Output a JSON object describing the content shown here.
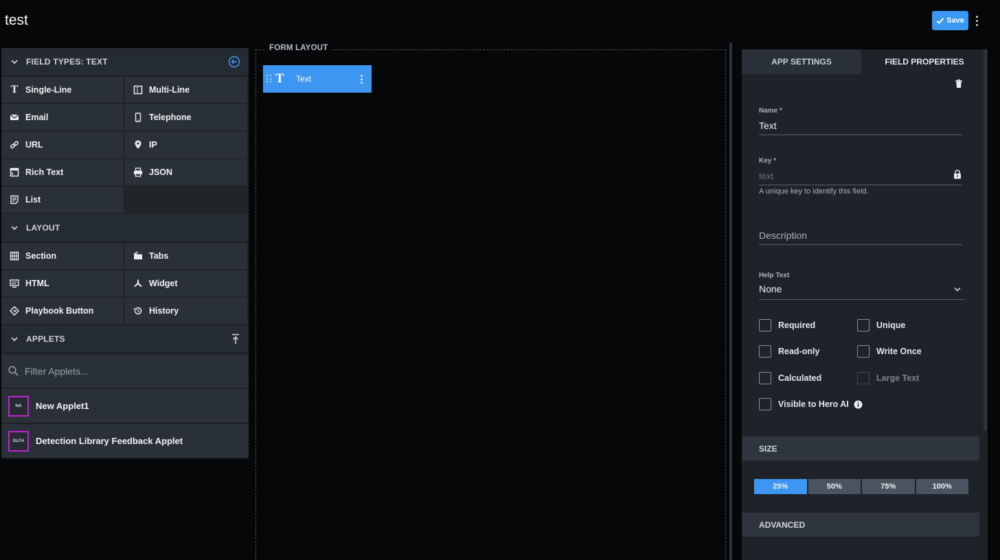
{
  "header": {
    "title": "test",
    "save_label": "Save"
  },
  "left": {
    "field_types_title": "FIELD TYPES: TEXT",
    "field_types": [
      {
        "label": "Single-Line",
        "icon": "text-t-icon"
      },
      {
        "label": "Multi-Line",
        "icon": "multi-line-icon"
      },
      {
        "label": "Email",
        "icon": "envelope-icon"
      },
      {
        "label": "Telephone",
        "icon": "phone-icon"
      },
      {
        "label": "URL",
        "icon": "link-icon"
      },
      {
        "label": "IP",
        "icon": "location-pin-icon"
      },
      {
        "label": "Rich Text",
        "icon": "rich-text-icon"
      },
      {
        "label": "JSON",
        "icon": "printer-icon"
      },
      {
        "label": "List",
        "icon": "list-doc-icon"
      }
    ],
    "layout_title": "LAYOUT",
    "layout_types": [
      {
        "label": "Section",
        "icon": "grid-icon"
      },
      {
        "label": "Tabs",
        "icon": "folder-tabs-icon"
      },
      {
        "label": "HTML",
        "icon": "html-icon"
      },
      {
        "label": "Widget",
        "icon": "widget-icon"
      },
      {
        "label": "Playbook Button",
        "icon": "diamond-icon"
      },
      {
        "label": "History",
        "icon": "history-icon"
      }
    ],
    "applets_title": "APPLETS",
    "filter_placeholder": "Filter Applets...",
    "applets": [
      {
        "badge": "NA",
        "name": "New Applet1"
      },
      {
        "badge": "DLFA",
        "name": "Detection Library Feedback Applet"
      }
    ]
  },
  "form": {
    "legend": "FORM LAYOUT",
    "fields": [
      {
        "label": "Text",
        "glyph": "T"
      }
    ]
  },
  "right": {
    "tabs": [
      "APP SETTINGS",
      "FIELD PROPERTIES"
    ],
    "active_tab": "FIELD PROPERTIES",
    "name_label": "Name *",
    "name_value": "Text",
    "key_label": "Key *",
    "key_value": "text",
    "key_hint": "A unique key to identify this field.",
    "description_placeholder": "Description",
    "help_text_label": "Help Text",
    "help_text_value": "None",
    "checkboxes": {
      "required": "Required",
      "unique": "Unique",
      "read_only": "Read-only",
      "write_once": "Write Once",
      "calculated": "Calculated",
      "large_text": "Large Text",
      "visible_hero_ai": "Visible to Hero AI"
    },
    "size_title": "SIZE",
    "sizes": [
      "25%",
      "50%",
      "75%",
      "100%"
    ],
    "selected_size": "25%",
    "advanced_title": "ADVANCED"
  },
  "colors": {
    "accent": "#3d97f2",
    "applet_badge_border": "#c51fd6",
    "background": "#060708",
    "panel": "#1f2429"
  }
}
